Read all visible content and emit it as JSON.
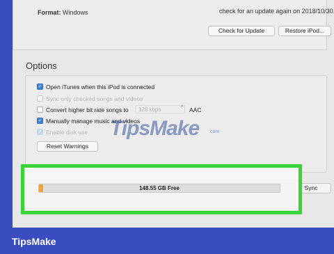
{
  "summary": {
    "format_label": "Format:",
    "format_value": "Windows",
    "update_text": "check for an update again on 2018/10/30.",
    "check_button": "Check for Update",
    "restore_button": "Restore iPod..."
  },
  "options": {
    "title": "Options",
    "items": [
      {
        "label": "Open iTunes when this iPod is connected",
        "checked": true,
        "enabled": true
      },
      {
        "label": "Sync only checked songs and videos",
        "checked": false,
        "enabled": false
      },
      {
        "label": "Convert higher bit rate songs to",
        "checked": false,
        "enabled": true
      },
      {
        "label": "Manually manage music and videos",
        "checked": true,
        "enabled": true
      },
      {
        "label": "Enable disk use",
        "checked": true,
        "enabled": false
      }
    ],
    "bitrate_value": "128 kbps",
    "format_value": "AAC",
    "reset_button": "Reset Warnings"
  },
  "storage": {
    "free_label": "148.55 GB Free",
    "used_fraction": 0.015,
    "used_color": "#f4a23a",
    "sync_button": "Sync"
  },
  "watermark": {
    "text": "TipsMake",
    "suffix": ".com"
  },
  "brand": "TipsMake",
  "colors": {
    "background": "#3a4dc0",
    "highlight_frame": "#3ad33a",
    "checkbox_on": "#3b82d8"
  }
}
